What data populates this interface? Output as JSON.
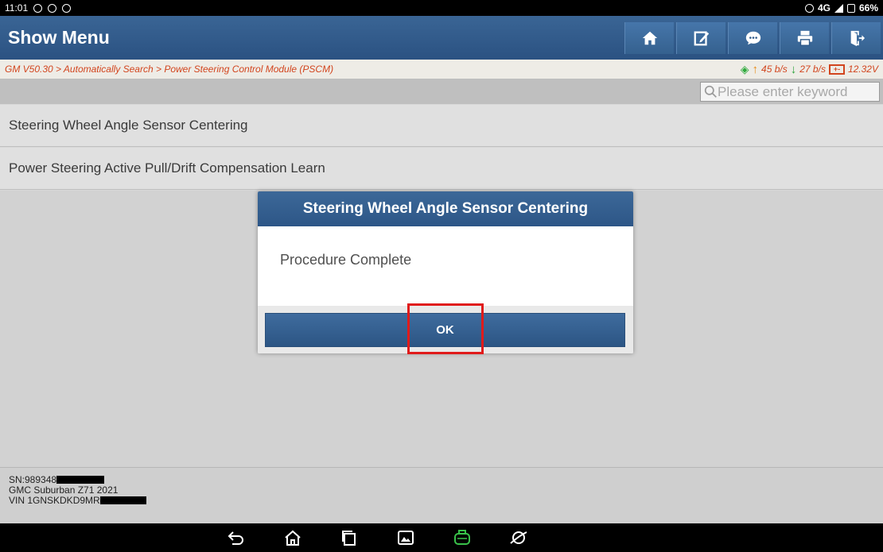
{
  "status_bar": {
    "time": "11:01",
    "battery": "66%",
    "network": "4G"
  },
  "header": {
    "title": "Show Menu",
    "buttons": [
      "home-icon",
      "edit-report-icon",
      "chat-icon",
      "print-icon",
      "exit-icon"
    ]
  },
  "breadcrumb": {
    "path": "GM V50.30 > Automatically Search > Power Steering Control Module (PSCM)",
    "upload_rate": "45 b/s",
    "download_rate": "27 b/s",
    "voltage": "12.32V"
  },
  "search": {
    "placeholder": "Please enter keyword"
  },
  "menu": {
    "items": [
      {
        "label": "Steering Wheel Angle Sensor Centering"
      },
      {
        "label": "Power Steering Active Pull/Drift Compensation Learn"
      }
    ]
  },
  "dialog": {
    "title": "Steering Wheel Angle Sensor Centering",
    "message": "Procedure Complete",
    "ok_label": "OK"
  },
  "vehicle_info": {
    "sn": "SN:989348",
    "vehicle": "GMC Suburban Z71 2021",
    "vin": "VIN 1GNSKDKD9MR"
  },
  "colors": {
    "header_blue": "#2b5282",
    "breadcrumb_text": "#d2451e",
    "highlight": "#e01b1b"
  }
}
